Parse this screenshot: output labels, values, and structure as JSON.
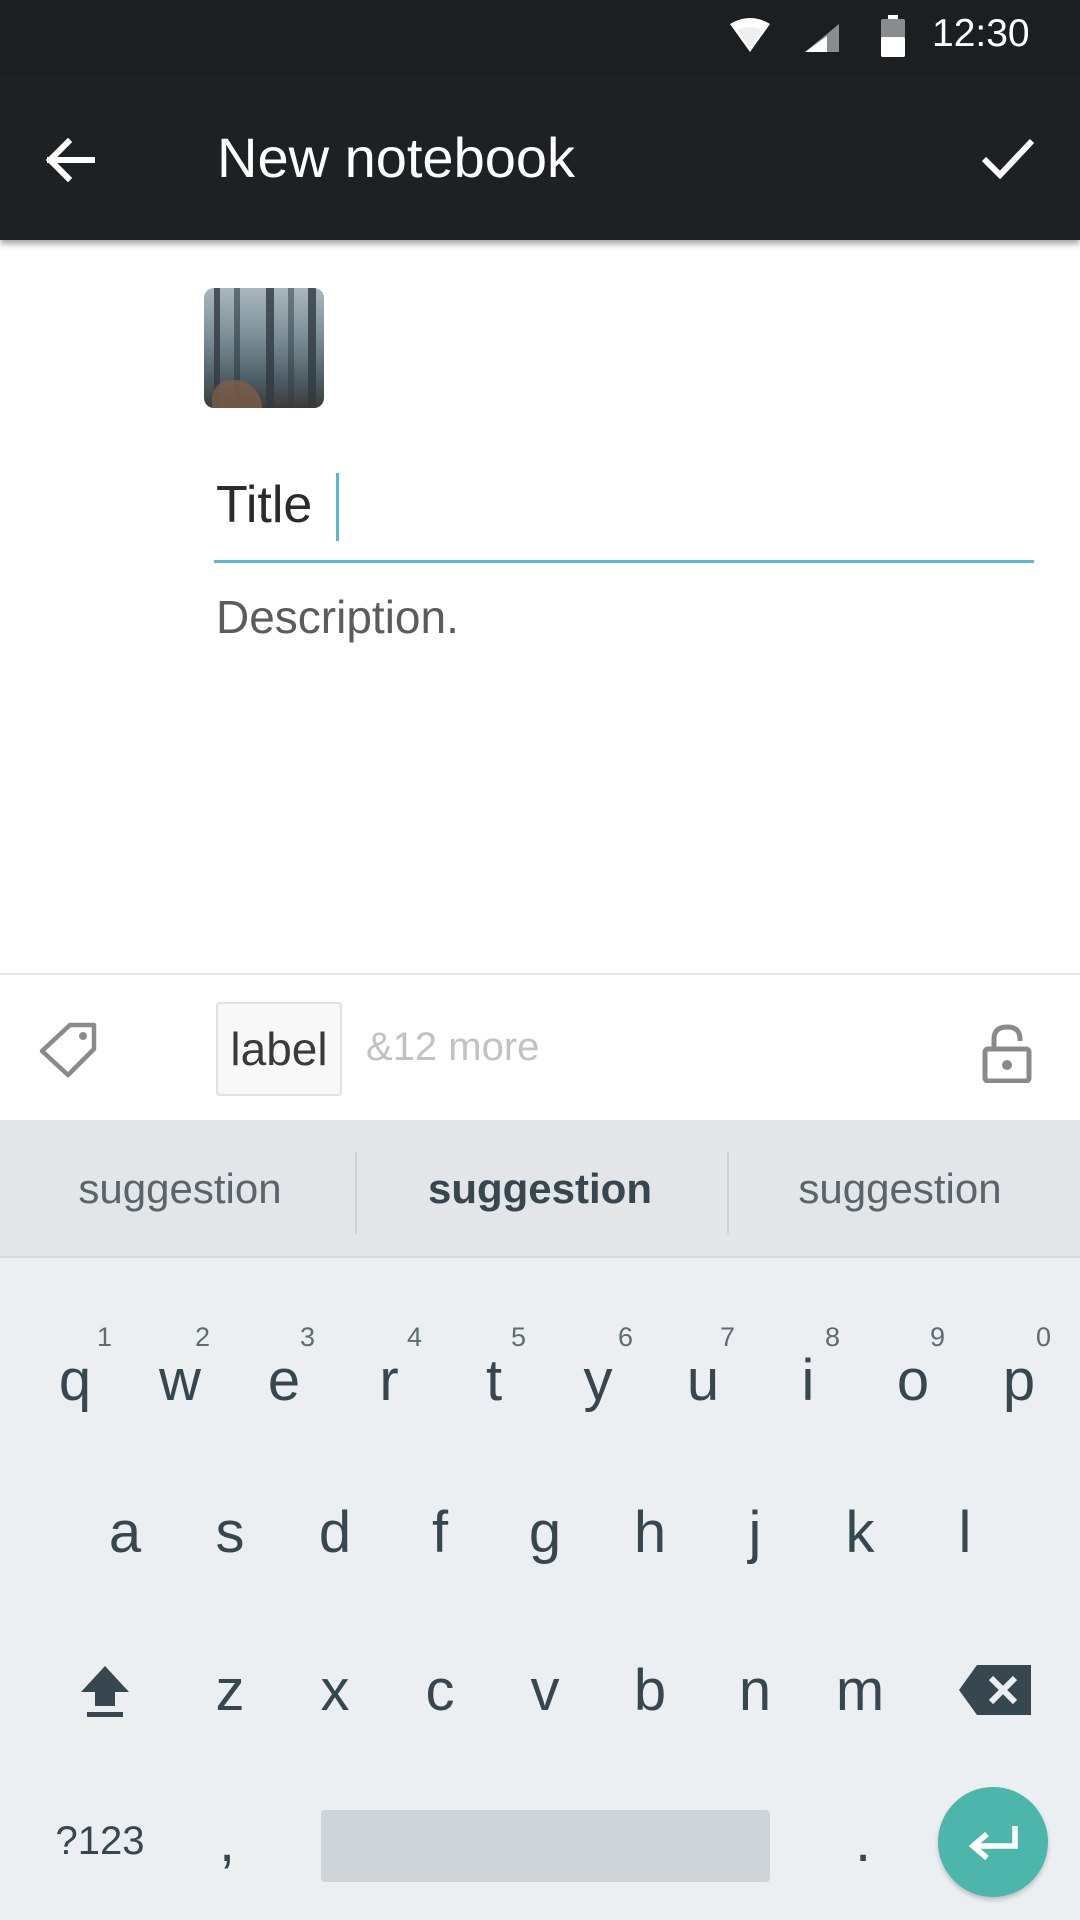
{
  "status_bar": {
    "time": "12:30",
    "icons": [
      "wifi-icon",
      "cell-signal-icon",
      "battery-icon"
    ]
  },
  "toolbar": {
    "title": "New notebook",
    "back_icon": "arrow-left-icon",
    "confirm_icon": "check-icon"
  },
  "form": {
    "cover_image": "forest-path-thumbnail",
    "title_value": "Title",
    "description_placeholder": "Description."
  },
  "labels": {
    "tag_icon": "tag-icon",
    "chip_label": "label",
    "more_text": "&12 more",
    "lock_icon": "lock-open-icon"
  },
  "keyboard": {
    "suggestions": [
      "suggestion",
      "suggestion",
      "suggestion"
    ],
    "row1": [
      "q",
      "w",
      "e",
      "r",
      "t",
      "y",
      "u",
      "i",
      "o",
      "p"
    ],
    "row1_hints": [
      "1",
      "2",
      "3",
      "4",
      "5",
      "6",
      "7",
      "8",
      "9",
      "0"
    ],
    "row2": [
      "a",
      "s",
      "d",
      "f",
      "g",
      "h",
      "j",
      "k",
      "l"
    ],
    "row3": [
      "z",
      "x",
      "c",
      "v",
      "b",
      "n",
      "m"
    ],
    "symbols_key": "?123",
    "comma_key": ",",
    "period_key": ".",
    "shift_icon": "shift-icon",
    "backspace_icon": "backspace-icon",
    "enter_icon": "enter-icon"
  },
  "colors": {
    "accent": "#5ab7d8",
    "toolbar_bg": "#1e2124",
    "enter_key": "#4db6ac"
  }
}
